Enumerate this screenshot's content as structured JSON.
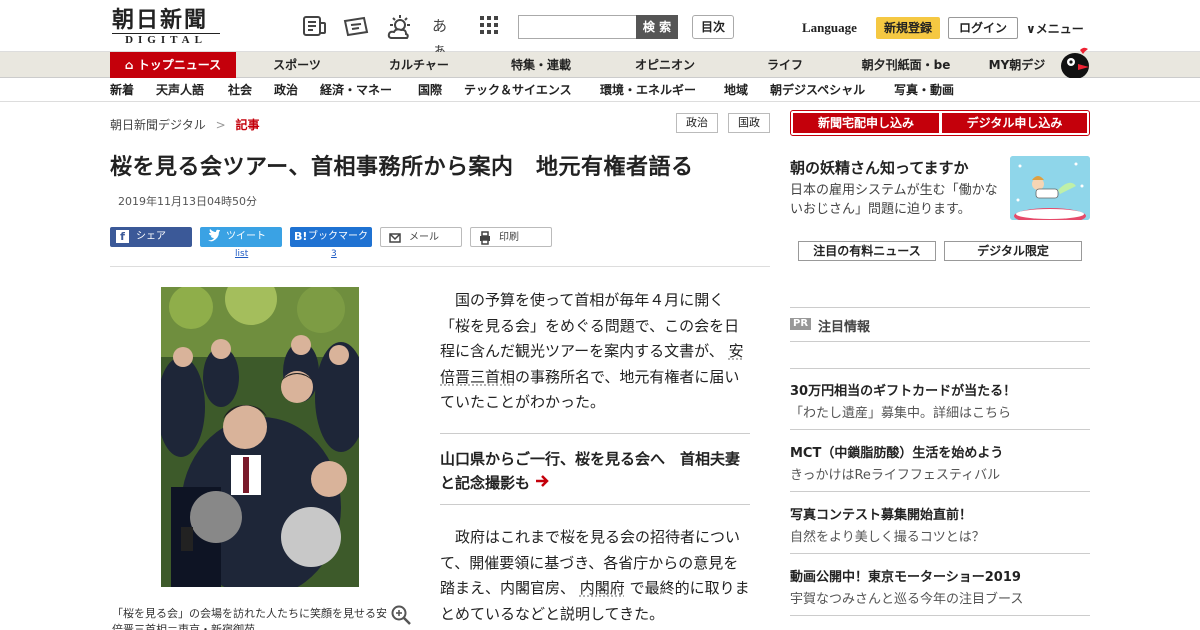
{
  "logo": {
    "main": "朝日新聞",
    "sub": "DIGITAL"
  },
  "header": {
    "icons": [
      "newspaper-icon",
      "coupon-icon",
      "weather-icon",
      "font-size-icon",
      "grid-icon"
    ],
    "font_icon_label": "あぁ",
    "search_placeholder": "",
    "search_label": "検 索",
    "toc_label": "目次",
    "language_label": "Language",
    "register_label": "新規登録",
    "login_label": "ログイン",
    "menu_label": "メニュー"
  },
  "nav_main": [
    "トップニュース",
    "スポーツ",
    "カルチャー",
    "特集・連載",
    "オピニオン",
    "ライフ",
    "朝夕刊紙面・be",
    "MY朝デジ"
  ],
  "nav_sub": [
    "新着",
    "天声人語",
    "社会",
    "政治",
    "経済・マネー",
    "国際",
    "テック＆サイエンス",
    "環境・エネルギー",
    "地域",
    "朝デジスペシャル",
    "写真・動画"
  ],
  "breadcrumb": {
    "home": "朝日新聞デジタル",
    "sep": ">",
    "current": "記事"
  },
  "tags": [
    "政治",
    "国政"
  ],
  "article": {
    "title": "桜を見る会ツアー、首相事務所から案内　地元有権者語る",
    "date": "2019年11月13日04時50分",
    "share": {
      "facebook": "シェア",
      "twitter": "ツイート",
      "hatena": "ブックマーク",
      "mail": "メール",
      "print": "印刷",
      "tweet_count": "list",
      "bookmark_count": "3"
    },
    "p1_before": "国の予算を使って首相が毎年４月に開く「桜を見る会」をめぐる問題で、この会を日程に含んだ観光ツアーを案内する文書が、",
    "p1_link": "安倍晋三首相",
    "p1_after": "の事務所名で、地元有権者に届いていたことがわかった。",
    "related": "山口県からご一行、桜を見る会へ　首相夫妻と記念撮影も",
    "p2_before": "政府はこれまで桜を見る会の招待者について、開催要領に基づき、各省庁からの意見を踏まえ、内閣官房、",
    "p2_link": "内閣府",
    "p2_after": "で最終的に取りまとめているなどと説明してきた。",
    "caption": "「桜を見る会」の会場を訪れた人たちに笑顔を見せる安倍晋三首相＝東京・新宿御苑"
  },
  "sidebar": {
    "btn_delivery": "新聞宅配申し込み",
    "btn_digital": "デジタル申し込み",
    "ad_title": "朝の妖精さん知ってますか",
    "ad_text": "日本の雇用システムが生む「働かないおじさん」問題に迫ります。",
    "tab_paid": "注目の有料ニュース",
    "tab_digital": "デジタル限定",
    "pr_badge": "PR",
    "pr_heading": "注目情報",
    "pr_items": [
      {
        "title": "30万円相当のギフトカードが当たる！",
        "sub": "「わたし遺産」募集中。詳細はこちら"
      },
      {
        "title": "MCT（中鎖脂肪酸）生活を始めよう",
        "sub": "きっかけはReライフフェスティバル"
      },
      {
        "title": "写真コンテスト募集開始直前！",
        "sub": "自然をより美しく撮るコツとは？"
      },
      {
        "title": "動画公開中！東京モーターショー2019",
        "sub": "宇賀なつみさんと巡る今年の注目ブース"
      }
    ]
  },
  "colors": {
    "brand_red": "#c4000b",
    "nav_bg": "#e9e7df",
    "register_yellow": "#f5c842"
  }
}
